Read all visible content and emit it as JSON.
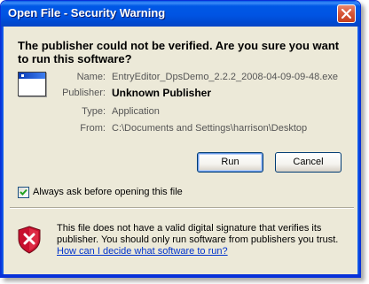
{
  "window": {
    "title": "Open File - Security Warning"
  },
  "dialog": {
    "heading": "The publisher could not be verified.  Are you sure you want to run this software?",
    "fields": [
      {
        "label": "Name:",
        "value": "EntryEditor_DpsDemo_2.2.2_2008-04-09-09-48.exe"
      },
      {
        "label": "Publisher:",
        "value": "Unknown Publisher"
      },
      {
        "label": "Type:",
        "value": "Application"
      },
      {
        "label": "From:",
        "value": "C:\\Documents and Settings\\harrison\\Desktop"
      }
    ],
    "buttons": {
      "run": "Run",
      "cancel": "Cancel"
    },
    "checkbox": {
      "label": "Always ask before opening this file",
      "checked": true
    },
    "warning": {
      "text": "This file does not have a valid digital signature that verifies its publisher.  You should only run software from publishers you trust.",
      "link": "How can I decide what software to run?"
    }
  },
  "icons": {
    "close": "close-icon",
    "app": "application-icon",
    "shield": "shield-warning-icon",
    "check": "check-icon"
  },
  "colors": {
    "titlebar": "#0054e3",
    "dialog_bg": "#ece9d8",
    "link": "#0033cc",
    "close_button": "#d8583a",
    "shield_red": "#c8102e"
  }
}
